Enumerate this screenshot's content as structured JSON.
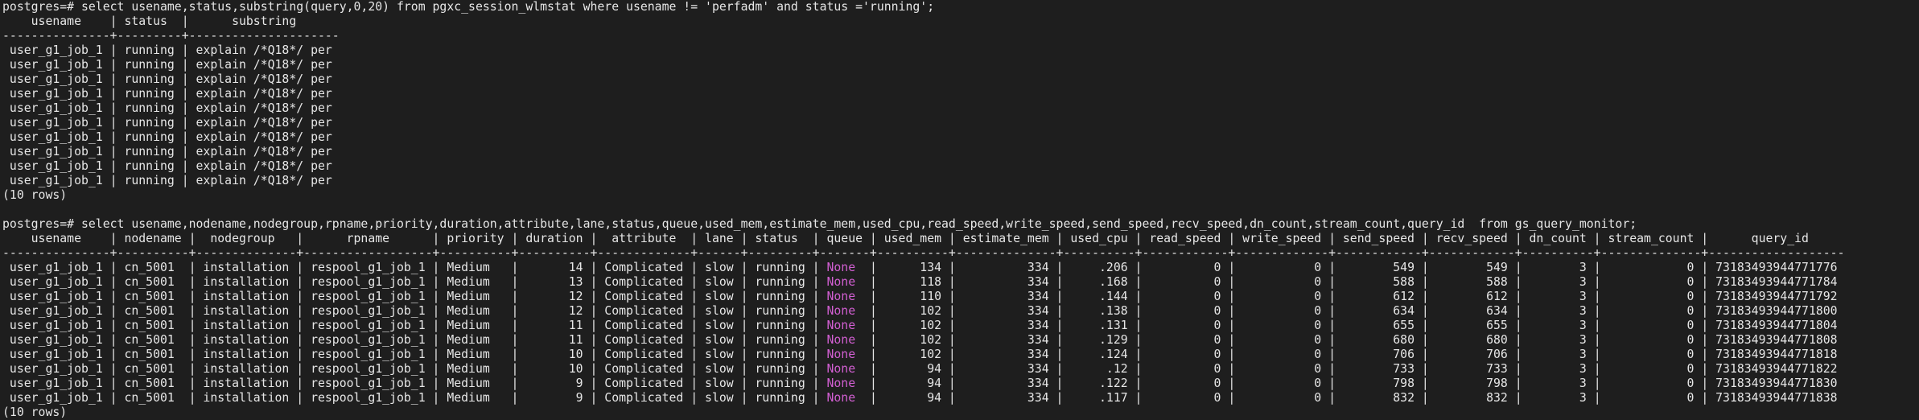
{
  "terminal": {
    "highlight_color": "#d25fd2",
    "text_color": "#e6e6e6",
    "background_color": "#1e1e1e",
    "lines": [
      [
        {
          "t": "postgres=# select usename,status,substring(query,0,20) from pgxc_session_wlmstat where usename != 'perfadm' and status ='running';"
        }
      ],
      [
        {
          "t": "    usename    | status  |      substring"
        }
      ],
      [
        {
          "t": "---------------+---------+---------------------"
        }
      ],
      [
        {
          "t": " user_g1_job_1 | running | explain /*Q18*/ per"
        }
      ],
      [
        {
          "t": " user_g1_job_1 | running | explain /*Q18*/ per"
        }
      ],
      [
        {
          "t": " user_g1_job_1 | running | explain /*Q18*/ per"
        }
      ],
      [
        {
          "t": " user_g1_job_1 | running | explain /*Q18*/ per"
        }
      ],
      [
        {
          "t": " user_g1_job_1 | running | explain /*Q18*/ per"
        }
      ],
      [
        {
          "t": " user_g1_job_1 | running | explain /*Q18*/ per"
        }
      ],
      [
        {
          "t": " user_g1_job_1 | running | explain /*Q18*/ per"
        }
      ],
      [
        {
          "t": " user_g1_job_1 | running | explain /*Q18*/ per"
        }
      ],
      [
        {
          "t": " user_g1_job_1 | running | explain /*Q18*/ per"
        }
      ],
      [
        {
          "t": " user_g1_job_1 | running | explain /*Q18*/ per"
        }
      ],
      [
        {
          "t": "(10 rows)"
        }
      ],
      [
        {
          "t": ""
        }
      ],
      [
        {
          "t": "postgres=# select usename,nodename,nodegroup,rpname,priority,duration,attribute,lane,status,queue,used_mem,estimate_mem,used_cpu,read_speed,write_speed,send_speed,recv_speed,dn_count,stream_count,query_id  from gs_query_monitor;"
        }
      ],
      [
        {
          "t": "    usename    | nodename |  nodegroup   |      rpname      | priority | duration |  attribute  | lane | status  | queue | used_mem | estimate_mem | used_cpu | read_speed | write_speed | send_speed | recv_speed | dn_count | stream_count |      query_id"
        }
      ],
      [
        {
          "t": "---------------+----------+--------------+------------------+----------+----------+-------------+------+---------+-------+----------+--------------+----------+------------+-------------+------------+------------+----------+--------------+-------------------"
        }
      ],
      [
        {
          "t": " user_g1_job_1 | cn_5001  | installation | respool_g1_job_1 | Medium   |       14 | Complicated | slow | running | "
        },
        {
          "t": "None",
          "hl": true
        },
        {
          "t": "  |      134 |          334 |     .206 |          0 |           0 |        549 |        549 |        3 |            0 | 73183493944771776"
        }
      ],
      [
        {
          "t": " user_g1_job_1 | cn_5001  | installation | respool_g1_job_1 | Medium   |       13 | Complicated | slow | running | "
        },
        {
          "t": "None",
          "hl": true
        },
        {
          "t": "  |      118 |          334 |     .168 |          0 |           0 |        588 |        588 |        3 |            0 | 73183493944771784"
        }
      ],
      [
        {
          "t": " user_g1_job_1 | cn_5001  | installation | respool_g1_job_1 | Medium   |       12 | Complicated | slow | running | "
        },
        {
          "t": "None",
          "hl": true
        },
        {
          "t": "  |      110 |          334 |     .144 |          0 |           0 |        612 |        612 |        3 |            0 | 73183493944771792"
        }
      ],
      [
        {
          "t": " user_g1_job_1 | cn_5001  | installation | respool_g1_job_1 | Medium   |       12 | Complicated | slow | running | "
        },
        {
          "t": "None",
          "hl": true
        },
        {
          "t": "  |      102 |          334 |     .138 |          0 |           0 |        634 |        634 |        3 |            0 | 73183493944771800"
        }
      ],
      [
        {
          "t": " user_g1_job_1 | cn_5001  | installation | respool_g1_job_1 | Medium   |       11 | Complicated | slow | running | "
        },
        {
          "t": "None",
          "hl": true
        },
        {
          "t": "  |      102 |          334 |     .131 |          0 |           0 |        655 |        655 |        3 |            0 | 73183493944771804"
        }
      ],
      [
        {
          "t": " user_g1_job_1 | cn_5001  | installation | respool_g1_job_1 | Medium   |       11 | Complicated | slow | running | "
        },
        {
          "t": "None",
          "hl": true
        },
        {
          "t": "  |      102 |          334 |     .129 |          0 |           0 |        680 |        680 |        3 |            0 | 73183493944771808"
        }
      ],
      [
        {
          "t": " user_g1_job_1 | cn_5001  | installation | respool_g1_job_1 | Medium   |       10 | Complicated | slow | running | "
        },
        {
          "t": "None",
          "hl": true
        },
        {
          "t": "  |      102 |          334 |     .124 |          0 |           0 |        706 |        706 |        3 |            0 | 73183493944771818"
        }
      ],
      [
        {
          "t": " user_g1_job_1 | cn_5001  | installation | respool_g1_job_1 | Medium   |       10 | Complicated | slow | running | "
        },
        {
          "t": "None",
          "hl": true
        },
        {
          "t": "  |       94 |          334 |      .12 |          0 |           0 |        733 |        733 |        3 |            0 | 73183493944771822"
        }
      ],
      [
        {
          "t": " user_g1_job_1 | cn_5001  | installation | respool_g1_job_1 | Medium   |        9 | Complicated | slow | running | "
        },
        {
          "t": "None",
          "hl": true
        },
        {
          "t": "  |       94 |          334 |     .122 |          0 |           0 |        798 |        798 |        3 |            0 | 73183493944771830"
        }
      ],
      [
        {
          "t": " user_g1_job_1 | cn_5001  | installation | respool_g1_job_1 | Medium   |        9 | Complicated | slow | running | "
        },
        {
          "t": "None",
          "hl": true
        },
        {
          "t": "  |       94 |          334 |     .117 |          0 |           0 |        832 |        832 |        3 |            0 | 73183493944771838"
        }
      ],
      [
        {
          "t": "(10 rows)"
        }
      ]
    ]
  }
}
